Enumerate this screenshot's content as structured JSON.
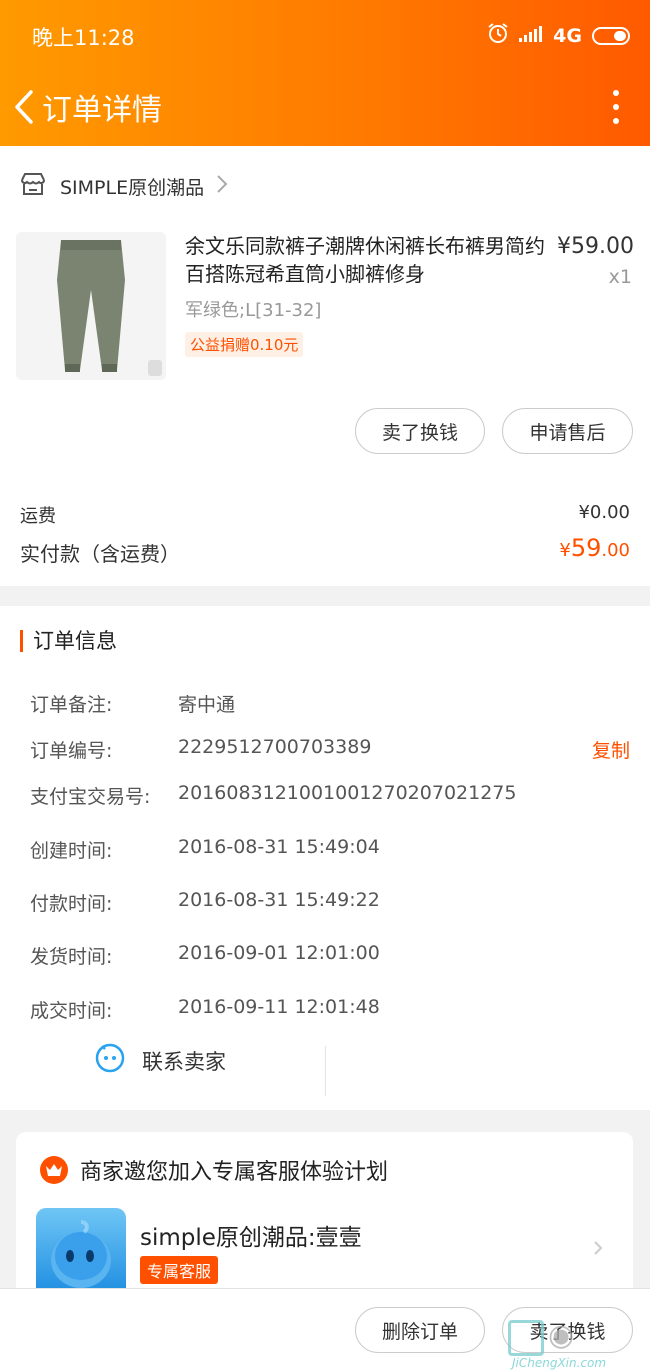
{
  "status_bar": {
    "time": "晚上11:28",
    "network": "4G"
  },
  "nav": {
    "title": "订单详情"
  },
  "shop": {
    "name": "SIMPLE原创潮品"
  },
  "product": {
    "title": "余文乐同款裤子潮牌休闲裤长布裤男简约百搭陈冠希直筒小脚裤修身",
    "price": "¥59.00",
    "quantity": "x1",
    "sku": "军绿色;L[31-32]",
    "charity": "公益捐赠0.10元"
  },
  "actions": {
    "sell": "卖了换钱",
    "after_sale": "申请售后"
  },
  "fees": {
    "shipping_label": "运费",
    "shipping_value": "¥0.00",
    "paid_label": "实付款（含运费）",
    "paid_currency": "¥",
    "paid_int": "59",
    "paid_dec": ".00"
  },
  "order_info": {
    "title": "订单信息",
    "rows": [
      {
        "key": "订单备注:",
        "value": "寄中通"
      },
      {
        "key": "订单编号:",
        "value": "2229512700703389"
      },
      {
        "key": "支付宝交易号:",
        "value": "2016083121001001270207021275"
      },
      {
        "key": "创建时间:",
        "value": "2016-08-31 15:49:04"
      },
      {
        "key": "付款时间:",
        "value": "2016-08-31 15:49:22"
      },
      {
        "key": "发货时间:",
        "value": "2016-09-01 12:01:00"
      },
      {
        "key": "成交时间:",
        "value": "2016-09-11 12:01:48"
      }
    ],
    "copy_label": "复制",
    "contact_label": "联系卖家"
  },
  "service": {
    "invite": "商家邀您加入专属客服体验计划",
    "name": "simple原创潮品:壹壹",
    "badge": "专属客服"
  },
  "bottom": {
    "delete": "删除订单",
    "sell": "卖了换钱"
  },
  "watermark": {
    "url": "JiChengXin.com"
  },
  "colors": {
    "accent": "#ff5000",
    "header_start": "#ff9a00",
    "header_end": "#ff5a00"
  }
}
